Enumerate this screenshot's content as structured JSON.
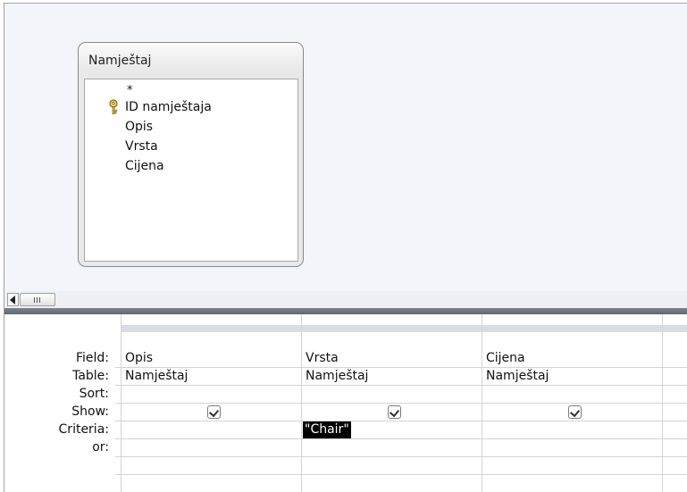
{
  "table": {
    "title": "Namještaj",
    "fields": [
      "*",
      "ID namještaja",
      "Opis",
      "Vrsta",
      "Cijena"
    ],
    "primary_key_icon": "key-icon"
  },
  "grid": {
    "row_labels": {
      "field": "Field:",
      "table": "Table:",
      "sort": "Sort:",
      "show": "Show:",
      "criteria": "Criteria:",
      "or": "or:"
    },
    "columns": [
      {
        "field": "Opis",
        "table": "Namještaj",
        "sort": "",
        "show": true,
        "criteria": "",
        "or": ""
      },
      {
        "field": "Vrsta",
        "table": "Namještaj",
        "sort": "",
        "show": true,
        "criteria": "\"Chair\"",
        "or": ""
      },
      {
        "field": "Cijena",
        "table": "Namještaj",
        "sort": "",
        "show": true,
        "criteria": "",
        "or": ""
      }
    ]
  },
  "colors": {
    "upper_bg": "#f2f5f9",
    "splitter": "#6b727c",
    "criteria_highlight_bg": "#000000",
    "criteria_highlight_fg": "#ffffff"
  }
}
